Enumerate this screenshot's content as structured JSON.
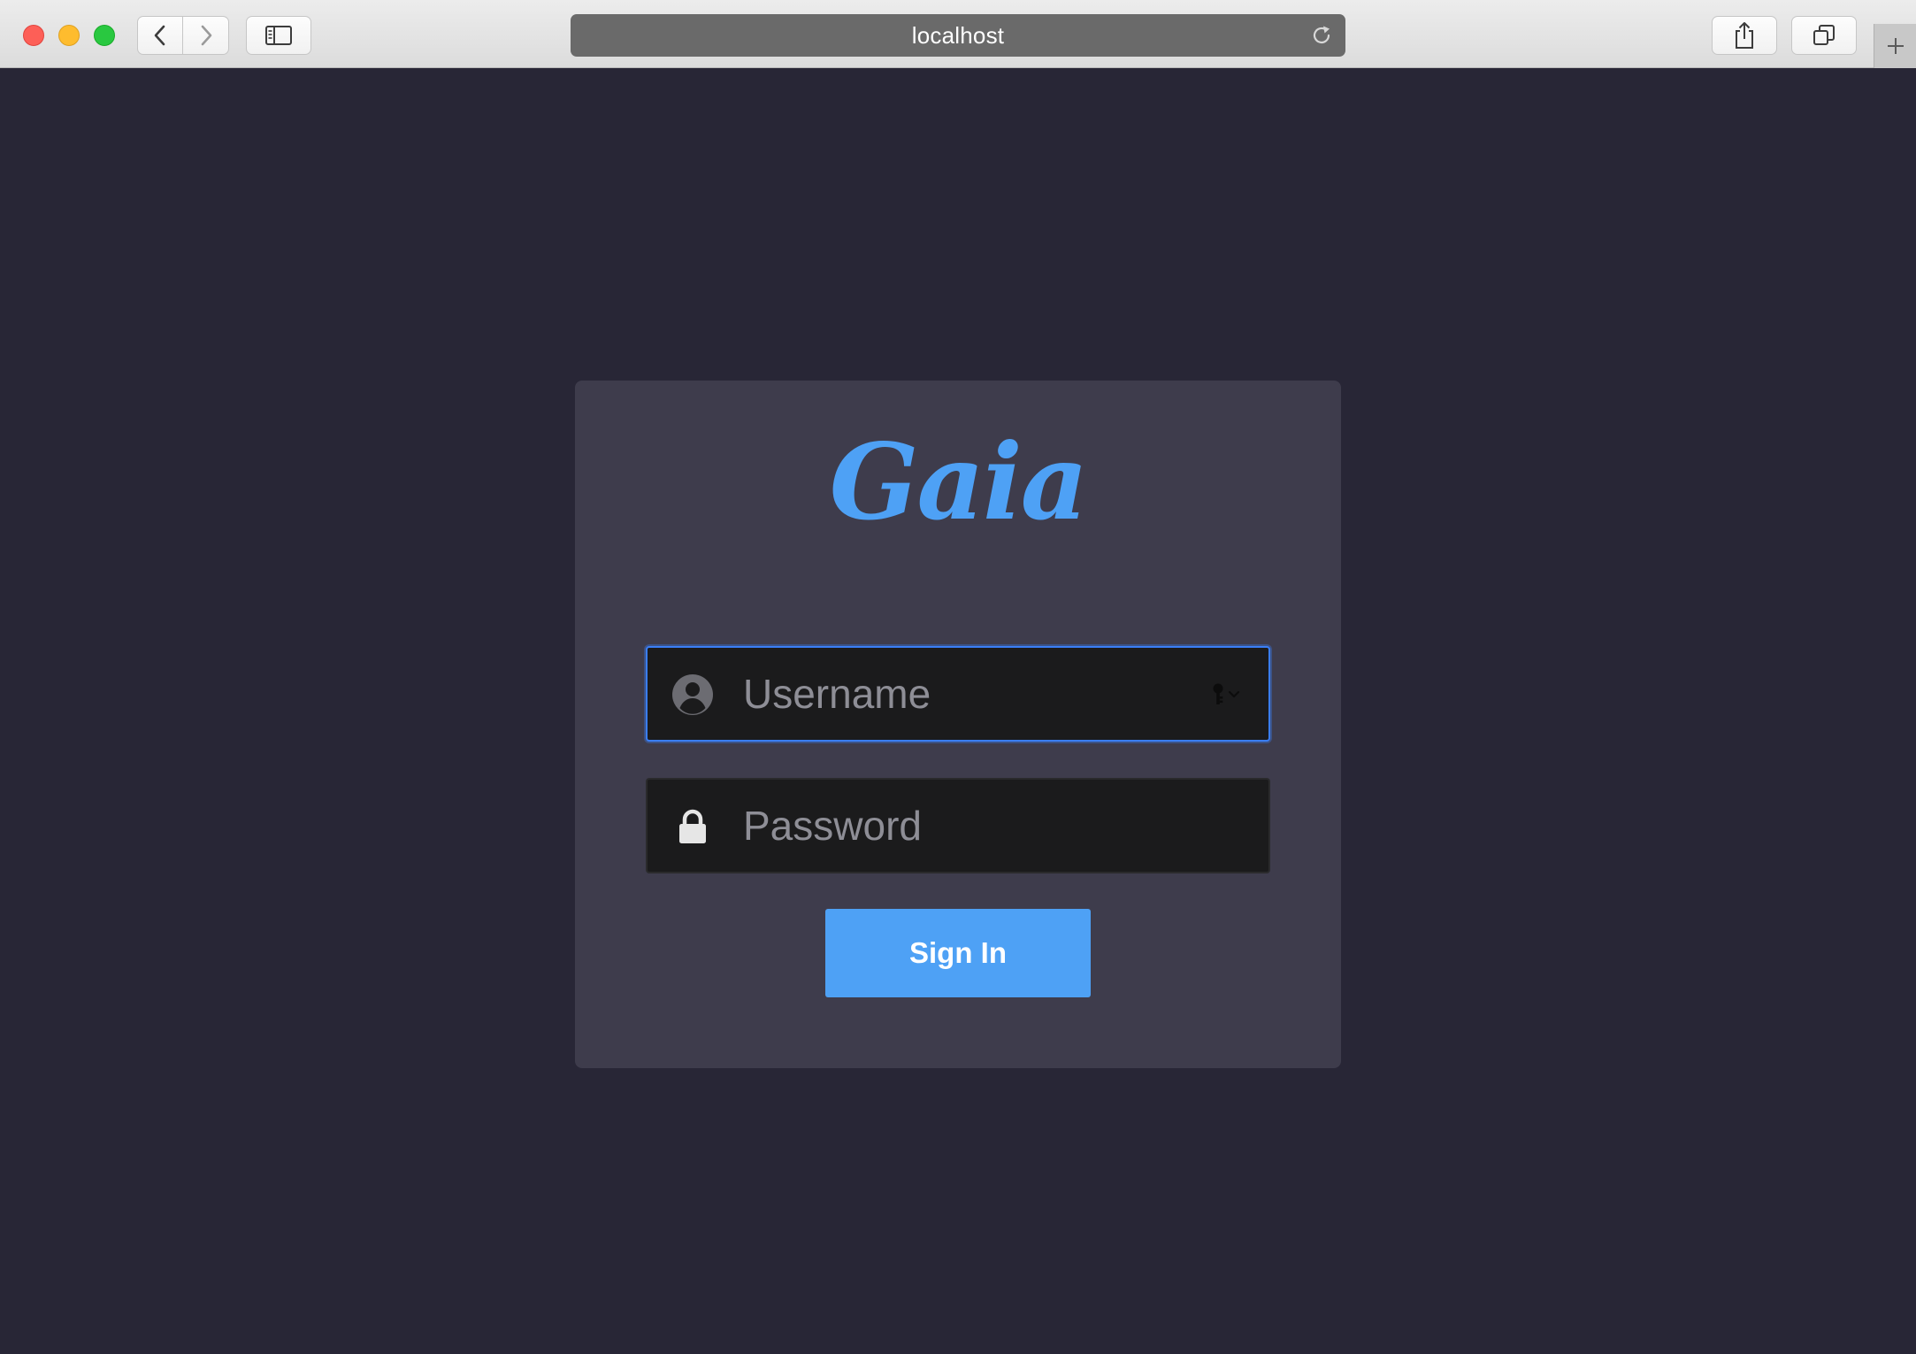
{
  "browser": {
    "address": "localhost",
    "icons": {
      "back": "chevron-left-icon",
      "forward": "chevron-right-icon",
      "sidebar": "sidebar-icon",
      "reload": "reload-icon",
      "share": "share-icon",
      "tabs": "tabs-overview-icon",
      "new_tab": "plus-icon"
    }
  },
  "login": {
    "logo": "Gaia",
    "username": {
      "value": "",
      "placeholder": "Username",
      "icon": "user-icon"
    },
    "password": {
      "value": "",
      "placeholder": "Password",
      "icon": "lock-icon"
    },
    "sign_in_label": "Sign In"
  },
  "colors": {
    "background": "#282636",
    "card": "#3e3c4c",
    "accent": "#4ea1f5",
    "field": "#1b1b1c",
    "focus_ring": "#3a7ef6"
  }
}
